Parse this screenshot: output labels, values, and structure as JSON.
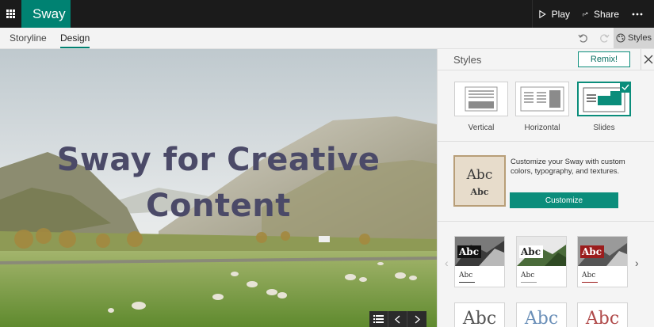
{
  "app": {
    "name": "Sway",
    "accent": "#008272"
  },
  "topbar": {
    "play_label": "Play",
    "share_label": "Share",
    "more_icon": "ellipsis-icon",
    "waffle_icon": "app-launcher-icon"
  },
  "tabs": [
    {
      "label": "Storyline",
      "active": false
    },
    {
      "label": "Design",
      "active": true
    }
  ],
  "toolbar": {
    "undo_icon": "undo-icon",
    "redo_icon": "redo-icon",
    "styles_label": "Styles"
  },
  "preview": {
    "title_line1": "Sway for Creative",
    "title_line2": "Content"
  },
  "styles_pane": {
    "title": "Styles",
    "remix_label": "Remix!",
    "layouts": [
      {
        "label": "Vertical",
        "selected": false
      },
      {
        "label": "Horizontal",
        "selected": false
      },
      {
        "label": "Slides",
        "selected": true
      }
    ],
    "customize": {
      "thumb_big": "Abc",
      "thumb_small": "Abc",
      "description": "Customize your Sway with custom colors, typography, and textures.",
      "button_label": "Customize"
    },
    "themes": [
      {
        "label": "Abc",
        "small": "Abc",
        "accent": "#111111"
      },
      {
        "label": "Abc",
        "small": "Abc",
        "accent": "#ffffff"
      },
      {
        "label": "Abc",
        "small": "Abc",
        "accent": "#9b1c1c"
      }
    ],
    "font_themes": [
      {
        "label": "Abc",
        "color": "#555555"
      },
      {
        "label": "Abc",
        "color": "#6a8fb8"
      },
      {
        "label": "Abc",
        "color": "#b04a4a"
      }
    ]
  }
}
